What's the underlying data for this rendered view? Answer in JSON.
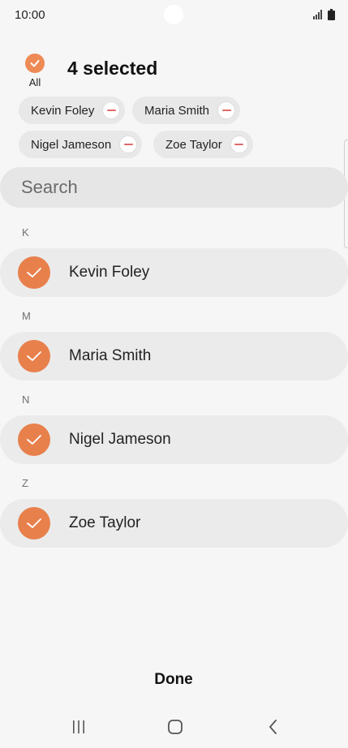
{
  "status_bar": {
    "time": "10:00",
    "icons": [
      "signal-icon",
      "battery-icon"
    ]
  },
  "header": {
    "select_all_label": "All",
    "title": "4 selected"
  },
  "chips": [
    {
      "label": "Kevin Foley"
    },
    {
      "label": "Maria Smith"
    },
    {
      "label": "Nigel Jameson"
    },
    {
      "label": "Zoe Taylor"
    }
  ],
  "search": {
    "placeholder": "Search",
    "value": ""
  },
  "contacts": [
    {
      "section": "K",
      "name": "Kevin Foley",
      "selected": true
    },
    {
      "section": "M",
      "name": "Maria Smith",
      "selected": true
    },
    {
      "section": "N",
      "name": "Nigel Jameson",
      "selected": true
    },
    {
      "section": "Z",
      "name": "Zoe Taylor",
      "selected": true
    }
  ],
  "footer": {
    "done_label": "Done"
  },
  "nav_bar": {
    "icons": [
      "recent-apps-icon",
      "home-icon",
      "back-icon"
    ]
  },
  "colors": {
    "accent": "#e8804c",
    "remove": "#e06a6a",
    "background": "#f6f6f6"
  }
}
